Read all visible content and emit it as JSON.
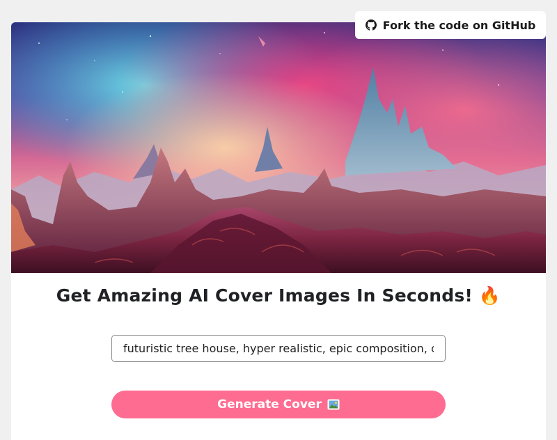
{
  "header": {
    "github_label": "Fork the code on GitHub",
    "github_icon": "github-icon"
  },
  "hero": {
    "image_icon": "landscape-image"
  },
  "main": {
    "headline": "Get Amazing AI Cover Images In Seconds! 🔥",
    "prompt_value": "futuristic tree house, hyper realistic, epic composition, cinematic",
    "generate_label": "Generate Cover",
    "generate_icon": "picture-icon"
  },
  "colors": {
    "page_background": "#f0f0f0",
    "button_pink": "#fe6d91",
    "headline_text": "#202124"
  }
}
